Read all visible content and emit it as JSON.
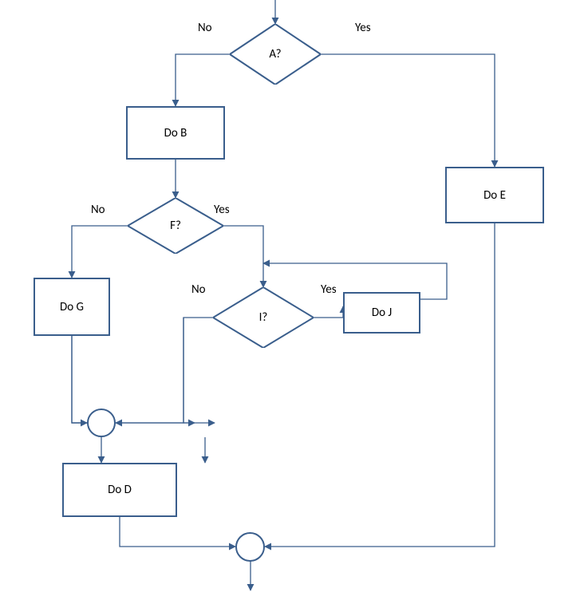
{
  "nodes": {
    "A": {
      "label": "A?"
    },
    "B": {
      "label": "Do B"
    },
    "F": {
      "label": "F?"
    },
    "G": {
      "label": "Do G"
    },
    "I": {
      "label": "I?"
    },
    "J": {
      "label": "Do J"
    },
    "D": {
      "label": "Do D"
    },
    "E": {
      "label": "Do E"
    }
  },
  "edges": {
    "A_no": {
      "label": "No"
    },
    "A_yes": {
      "label": "Yes"
    },
    "F_no": {
      "label": "No"
    },
    "F_yes": {
      "label": "Yes"
    },
    "I_no": {
      "label": "No"
    },
    "I_yes": {
      "label": "Yes"
    }
  },
  "colors": {
    "stroke": "#3a5e8c",
    "arrow": "#3a5e8c"
  }
}
